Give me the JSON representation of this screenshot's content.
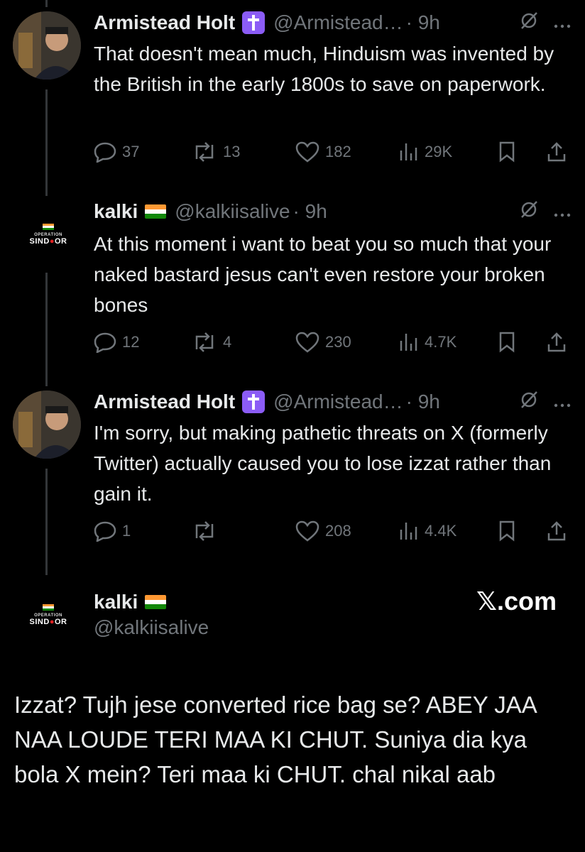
{
  "tweets": [
    {
      "name": "Armistead Holt",
      "handle": "@Armistead…",
      "time": "· 9h",
      "text": "That doesn't mean much, Hinduism was invented by the British in the early 1800s to save on paperwork.",
      "replies": "37",
      "reposts": "13",
      "likes": "182",
      "views": "29K"
    },
    {
      "name": "kalki",
      "handle": "@kalkiisalive",
      "time": "· 9h",
      "text": "At this moment i want to beat you so much that your naked bastard jesus can't even restore your broken bones",
      "replies": "12",
      "reposts": "4",
      "likes": "230",
      "views": "4.7K"
    },
    {
      "name": "Armistead Holt",
      "handle": "@Armistead…",
      "time": "· 9h",
      "text": "I'm sorry, but making pathetic threats on X (formerly Twitter) actually caused you to lose izzat rather than gain it.",
      "replies": "1",
      "reposts": "",
      "likes": "208",
      "views": "4.4K"
    }
  ],
  "final": {
    "name": "kalki",
    "handle": "@kalkiisalive",
    "brand": "𝕏.com",
    "text": "Izzat? Tujh jese converted rice bag se? ABEY JAA NAA LOUDE TERI MAA KI CHUT. Suniya dia kya bola X mein? Teri maa ki CHUT. chal nikal aab"
  },
  "logo": {
    "top": "OPERATION",
    "main_a": "SIND",
    "main_dot": "●",
    "main_b": "OR"
  },
  "colors": {
    "saffron": "#ff9933",
    "green": "#138808",
    "badge": "#8b5cf6",
    "muted": "#71767b"
  },
  "icons": [
    "reply-icon",
    "repost-icon",
    "like-icon",
    "views-icon",
    "bookmark-icon",
    "share-icon",
    "grok-icon",
    "more-icon",
    "cross-icon",
    "india-flag-icon"
  ]
}
